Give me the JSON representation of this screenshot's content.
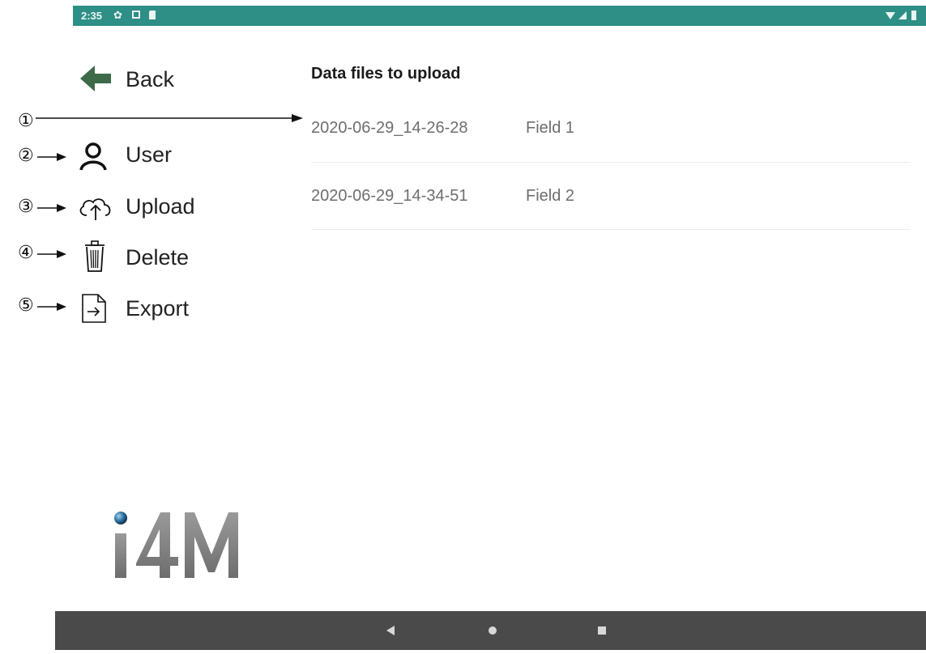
{
  "status_bar": {
    "time": "2:35",
    "icons": [
      "gear-icon",
      "notification-square-icon",
      "sd-card-icon"
    ],
    "right_icons": [
      "wifi-icon",
      "signal-icon",
      "battery-icon"
    ]
  },
  "sidebar": {
    "back_label": "Back",
    "items": [
      {
        "label": "User",
        "icon": "user-icon",
        "annotation": "②"
      },
      {
        "label": "Upload",
        "icon": "cloud-upload-icon",
        "annotation": "③"
      },
      {
        "label": "Delete",
        "icon": "trash-icon",
        "annotation": "④"
      },
      {
        "label": "Export",
        "icon": "export-file-icon",
        "annotation": "⑤"
      }
    ]
  },
  "annotations": {
    "file_list": "①"
  },
  "main": {
    "title": "Data files to upload",
    "files": [
      {
        "name": "2020-06-29_14-26-28",
        "field": "Field 1"
      },
      {
        "name": "2020-06-29_14-34-51",
        "field": "Field 2"
      }
    ]
  },
  "logo": {
    "text": "i4M"
  },
  "colors": {
    "status_bar": "#2e8f86",
    "nav_bar": "#4a4a4a",
    "back_arrow": "#3d6b4a"
  },
  "nav_bar": {
    "buttons": [
      "back-triangle-icon",
      "home-circle-icon",
      "recents-square-icon"
    ]
  }
}
